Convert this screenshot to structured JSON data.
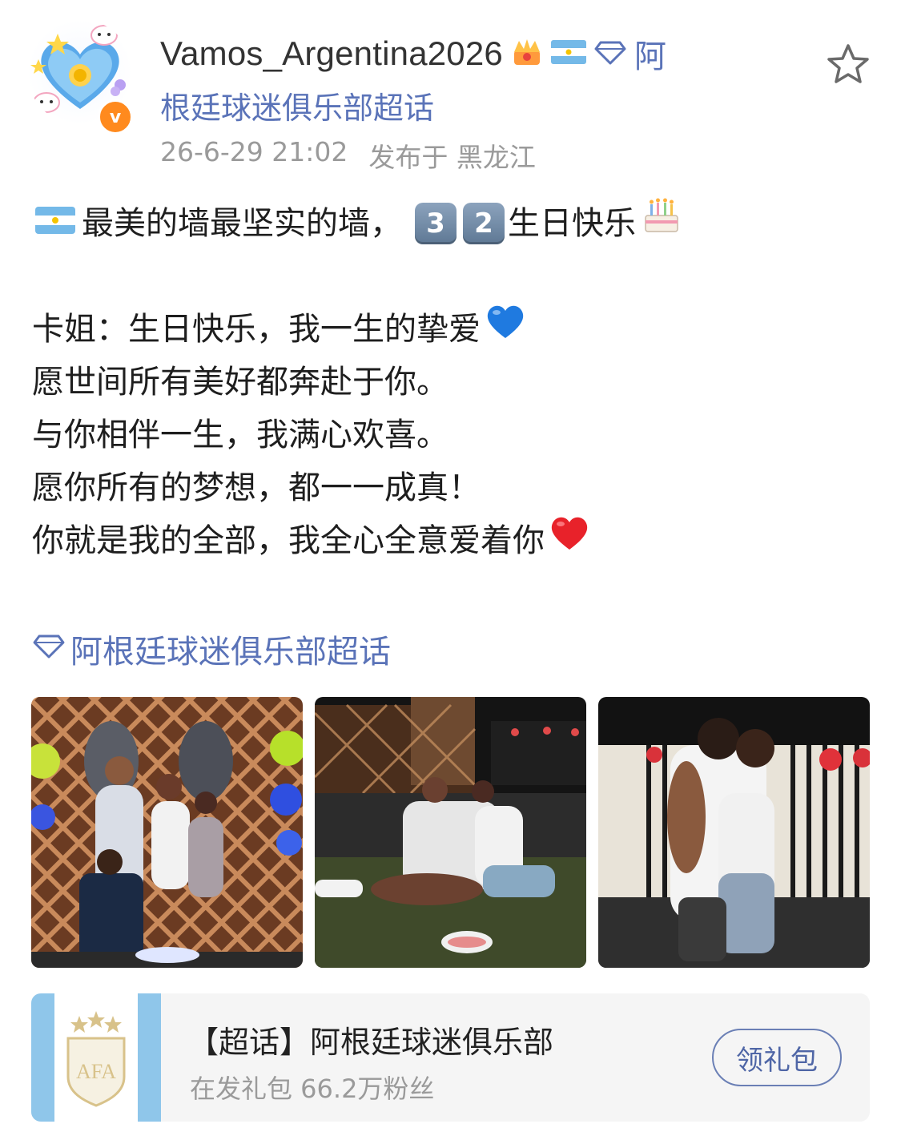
{
  "post": {
    "author": {
      "username": "Vamos_Argentina2026",
      "level_badge_text": "阿",
      "subtitle": "根廷球迷俱乐部超话",
      "verified_mark": "v"
    },
    "timestamp": "26-6-29 21:02",
    "location": "发布于 黑龙江",
    "text": {
      "line1_before": "最美的墙最坚实的墙，",
      "keycap_1": "3",
      "keycap_2": "2",
      "line1_after": "生日快乐",
      "line2": "卡姐：生日快乐，我一生的挚爱",
      "line3": "愿世间所有美好都奔赴于你。",
      "line4": "与你相伴一生，我满心欢喜。",
      "line5": "愿你所有的梦想，都一一成真！",
      "line6": "你就是我的全部，我全心全意爱着你"
    },
    "topic_link": "阿根廷球迷俱乐部超话",
    "icons": {
      "favorite": "star-outline-icon",
      "crown": "crown-icon",
      "flag": "argentina-flag-icon",
      "diamond": "diamond-icon",
      "cake": "birthday-cake-icon",
      "blue_heart": "blue-heart-icon",
      "red_heart": "red-heart-icon"
    }
  },
  "card": {
    "title": "【超话】阿根廷球迷俱乐部",
    "subtitle": "在发礼包 66.2万粉丝",
    "button_label": "领礼包",
    "logo_text": "AFA"
  },
  "colors": {
    "link_blue": "#5a73b8",
    "meta_gray": "#9a9a9a",
    "badge_orange": "#ff8a1e"
  }
}
